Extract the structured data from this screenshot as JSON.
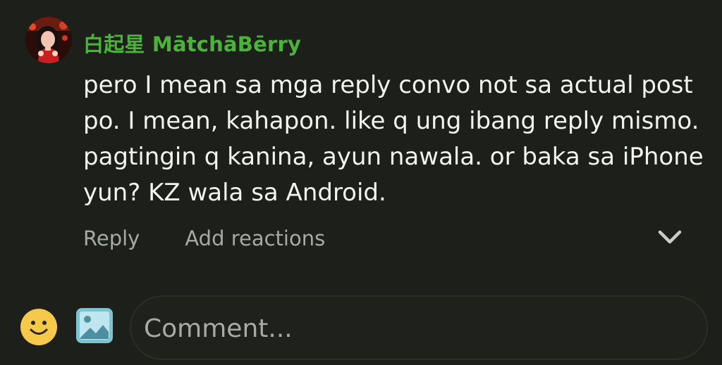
{
  "comment": {
    "author": "白起星 MātchāBērry",
    "text": "pero I mean sa mga reply convo not sa actual post po. I mean, kahapon. like q ung ibang reply mismo. pagtingin q kanina, ayun nawala. or baka sa iPhone yun? KZ wala sa Android.",
    "actions": {
      "reply": "Reply",
      "add_reactions": "Add reactions"
    },
    "icons": {
      "avatar": "avatar-photo",
      "expand": "chevron-down-icon"
    }
  },
  "composer": {
    "placeholder": "Comment...",
    "icons": {
      "emoji": "emoji-icon",
      "image": "image-icon"
    }
  },
  "colors": {
    "background": "#1d1f1a",
    "author_name": "#4bb23a",
    "body_text": "#f3f3f1",
    "muted_text": "#a6aaa5",
    "emoji_yellow": "#f6c94b",
    "image_icon": "#7cc4d1"
  }
}
